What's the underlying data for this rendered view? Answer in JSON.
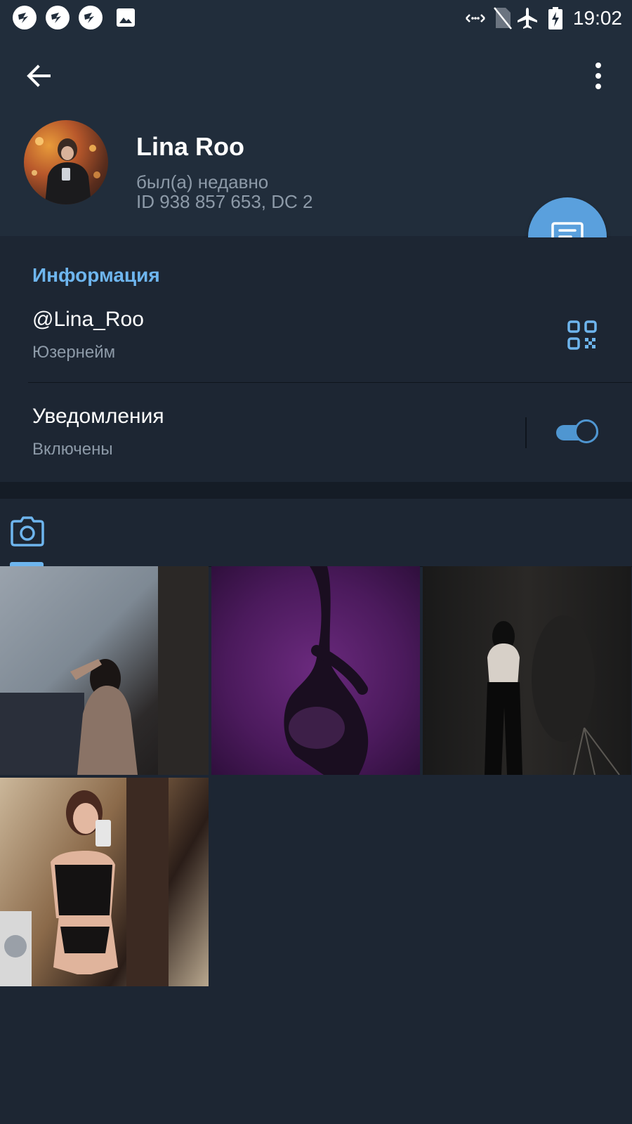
{
  "status_bar": {
    "time": "19:02",
    "notification_icons": [
      "app-notification-icon",
      "app-notification-icon",
      "app-notification-icon",
      "image-notification-icon"
    ],
    "system_icons": [
      "data-transfer-icon",
      "no-sim-icon",
      "airplane-icon",
      "battery-charging-icon"
    ]
  },
  "toolbar": {
    "back_icon": "arrow-left-icon",
    "menu_icon": "more-vert-icon"
  },
  "profile": {
    "name": "Lina Roo",
    "status": "был(а) недавно",
    "id_line": "ID 938 857 653, DC 2"
  },
  "fab": {
    "icon": "message-icon"
  },
  "info": {
    "section_title": "Информация",
    "username": {
      "value": "@Lina_Roo",
      "label": "Юзернейм"
    },
    "notifications": {
      "value": "Уведомления",
      "label": "Включены",
      "enabled": true
    }
  },
  "media": {
    "active_tab_icon": "camera-icon",
    "photos": 4
  },
  "colors": {
    "accent": "#6eb5ee",
    "fab": "#5aa0dd",
    "background": "#1d2633",
    "header": "#212d3b"
  }
}
